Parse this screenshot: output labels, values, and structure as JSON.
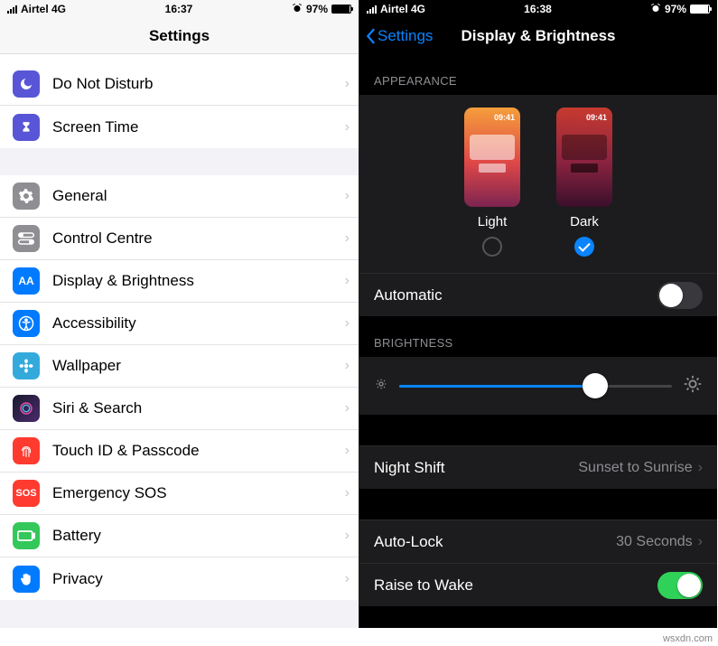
{
  "left": {
    "status": {
      "carrier": "Airtel 4G",
      "time": "16:37",
      "battery": "97%"
    },
    "nav": {
      "title": "Settings"
    },
    "rows": [
      {
        "label": "Do Not Disturb"
      },
      {
        "label": "Screen Time"
      },
      {
        "label": "General"
      },
      {
        "label": "Control Centre"
      },
      {
        "label": "Display & Brightness"
      },
      {
        "label": "Accessibility"
      },
      {
        "label": "Wallpaper"
      },
      {
        "label": "Siri & Search"
      },
      {
        "label": "Touch ID & Passcode"
      },
      {
        "label": "Emergency SOS"
      },
      {
        "label": "Battery"
      },
      {
        "label": "Privacy"
      }
    ]
  },
  "right": {
    "status": {
      "carrier": "Airtel 4G",
      "time": "16:38",
      "battery": "97%"
    },
    "nav": {
      "back": "Settings",
      "title": "Display & Brightness"
    },
    "appearance": {
      "header": "APPEARANCE",
      "thumb_time": "09:41",
      "light_label": "Light",
      "dark_label": "Dark",
      "automatic_label": "Automatic"
    },
    "brightness": {
      "header": "BRIGHTNESS",
      "value_pct": 72
    },
    "night_shift": {
      "label": "Night Shift",
      "value": "Sunset to Sunrise"
    },
    "auto_lock": {
      "label": "Auto-Lock",
      "value": "30 Seconds"
    },
    "raise_to_wake": {
      "label": "Raise to Wake"
    }
  },
  "watermark": "wsxdn.com"
}
